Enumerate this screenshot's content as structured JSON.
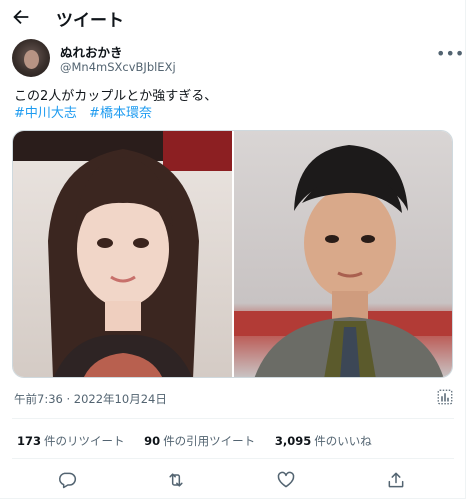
{
  "header": {
    "title": "ツイート"
  },
  "author": {
    "display_name": "ぬれおかき",
    "handle": "@Mn4mSXcvBJblEXj"
  },
  "tweet": {
    "text": "この2人がカップルとか強すぎる、",
    "hashtags": [
      "#中川大志",
      "#橋本環奈"
    ]
  },
  "meta": {
    "timestamp": "午前7:36 · 2022年10月24日"
  },
  "stats": [
    {
      "count": "173",
      "label": "件のリツイート"
    },
    {
      "count": "90",
      "label": "件の引用ツイート"
    },
    {
      "count": "3,095",
      "label": "件のいいね"
    }
  ],
  "icons": {
    "back": "back-arrow-icon",
    "more": "more-icon",
    "analytics": "analytics-icon",
    "reply": "reply-icon",
    "retweet": "retweet-icon",
    "like": "like-icon",
    "share": "share-icon"
  },
  "colors": {
    "link": "#1d9bf0",
    "muted": "#536471",
    "text": "#0f1419"
  }
}
